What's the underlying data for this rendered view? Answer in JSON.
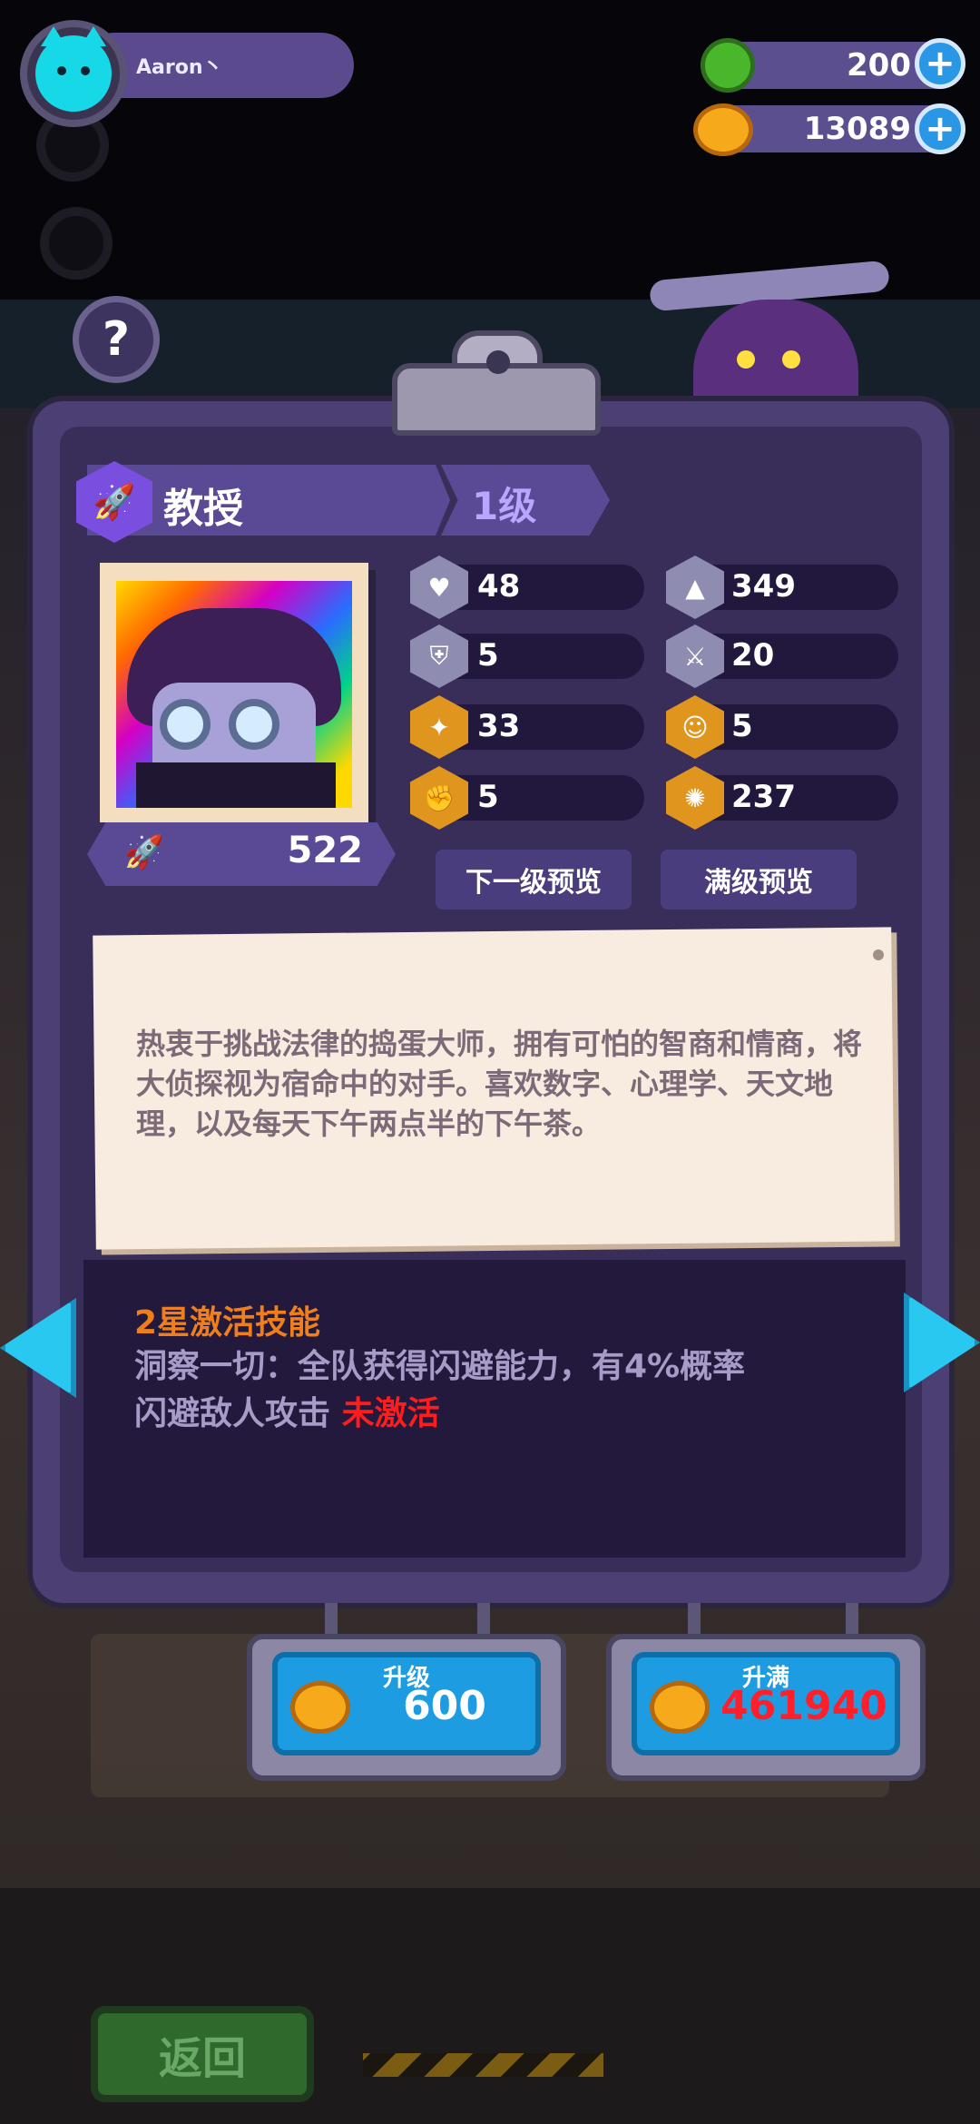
{
  "player": {
    "name": "Aaron丶"
  },
  "resources": {
    "gems": "200",
    "coins": "13089",
    "plus": "+"
  },
  "help": {
    "label": "?"
  },
  "character": {
    "title": "教授",
    "level": "1级",
    "power": "522",
    "class_icon": "rocket-icon"
  },
  "stats": {
    "hp": "48",
    "attack": "349",
    "defense": "5",
    "speed": "20",
    "stat_a": "33",
    "stat_b": "5",
    "stat_c": "5",
    "stat_d": "237"
  },
  "buttons": {
    "next_preview": "下一级预览",
    "max_preview": "满级预览",
    "upgrade_label": "升级",
    "upgrade_cost": "600",
    "max_label": "升满",
    "max_cost": "461940",
    "back": "返回"
  },
  "description": "热衷于挑战法律的捣蛋大师，拥有可怕的智商和情商，将大侦探视为宿命中的对手。喜欢数字、心理学、天文地理，以及每天下午两点半的下午茶。",
  "skill": {
    "title": "2星激活技能",
    "desc": "洞察一切：全队获得闪避能力，有4%概率闪避敌人攻击",
    "status": "未激活"
  },
  "colors": {
    "panel": "#4b3f73",
    "accent_blue": "#1e9ce2",
    "skill_title": "#f07e1a",
    "inactive": "#ff1c1c"
  }
}
